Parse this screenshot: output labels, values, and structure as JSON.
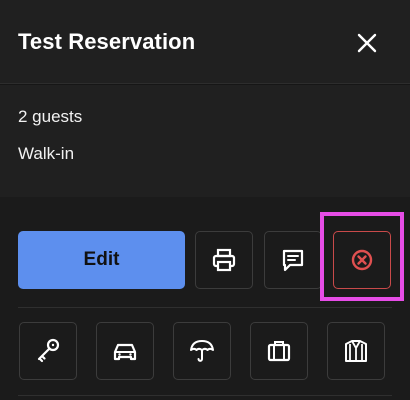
{
  "header": {
    "title": "Test Reservation",
    "close_icon": "close-icon"
  },
  "details": {
    "guests": "2 guests",
    "source": "Walk-in"
  },
  "actions": {
    "edit_label": "Edit",
    "print_icon": "printer-icon",
    "message_icon": "message-icon",
    "cancel_icon": "cancel-circle-icon",
    "highlight_color": "#e64de6",
    "primary_color": "#5d8fee",
    "cancel_color": "#e05050"
  },
  "quick_actions": [
    {
      "icon": "key-icon"
    },
    {
      "icon": "car-icon"
    },
    {
      "icon": "umbrella-icon"
    },
    {
      "icon": "luggage-icon"
    },
    {
      "icon": "coat-icon"
    }
  ]
}
